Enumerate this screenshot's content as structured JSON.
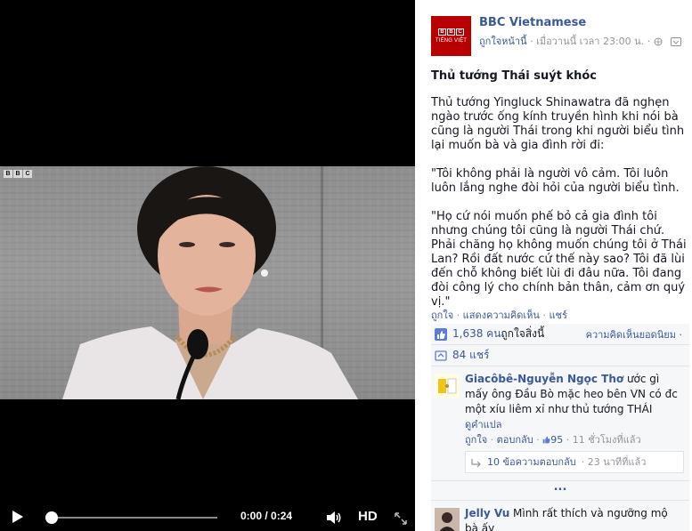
{
  "video": {
    "bbc_bug": [
      "B",
      "B",
      "C"
    ],
    "time_label": "0:00 / 0:24",
    "hd_label": "HD",
    "progress": 0
  },
  "post": {
    "logo_blocks": [
      "B",
      "B",
      "C"
    ],
    "logo_sub": "TIẾNG VIỆT",
    "page_name": "BBC Vietnamese",
    "like_page": "ถูกใจหน้านี้",
    "timestamp": "· เมื่อวานนี้ เวลา 23:00 น. ·",
    "title": "Thủ tướng Thái suýt khóc",
    "paragraphs": [
      "Thủ tướng Yingluck Shinawatra đã nghẹn ngào trước ống kính truyền hình khi nói bà cũng là người Thái trong khi người biểu tình lại muốn bà và gia đình rời đi:",
      "\"Tôi không phải là người vô cảm. Tôi luôn luôn lắng nghe đòi hỏi của người biểu tình.",
      "\"Họ cứ nói muốn phế bỏ cả gia đình tôi nhưng chúng tôi cũng là người Thái chứ. Phải chăng họ không muốn chúng tôi ở Thái Lan? Rồi đất nước cứ thế này sao? Tôi đã lùi đến chỗ không biết lùi đi đâu nữa. Tôi đang đòi công lý cho chính bản thân, cảm ơn quý vị.\""
    ],
    "actions": {
      "like": "ถูกใจ",
      "sep1": " · ",
      "comment": "แสดงความคิดเห็น",
      "sep2": " · ",
      "share": "แชร์"
    }
  },
  "ufi": {
    "likes_count": "1,638 คน",
    "likes_suffix": " ถูกใจสิ่งนี้",
    "sort_label": "ความคิดเห็นยอดนิยม ·",
    "shares": "84 แชร์",
    "comments": [
      {
        "name": "Giacôbê-Nguyễn Ngọc Thơ",
        "text": " ước gì mấy ông Đầu Bò mặc heo bên VN có đc một xíu liêm xỉ như thủ tướng THÁI",
        "translate": "ดูคำแปล",
        "like": "ถูกใจ",
        "reply": "ตอบกลับ",
        "like_count": "95",
        "time": "11 ชั่วโมงที่แล้ว",
        "replies_label": "10 ข้อความตอบกลับ",
        "replies_time": "· 23 นาทีที่แล้ว"
      },
      {
        "name": "Jelly Vu",
        "text": " Mình rất thích và ngưỡng mộ bà ấy"
      }
    ],
    "more_label": "..."
  },
  "colors": {
    "facebook_blue": "#3b5998",
    "bbc_red": "#b80000",
    "muted": "#90949c"
  }
}
